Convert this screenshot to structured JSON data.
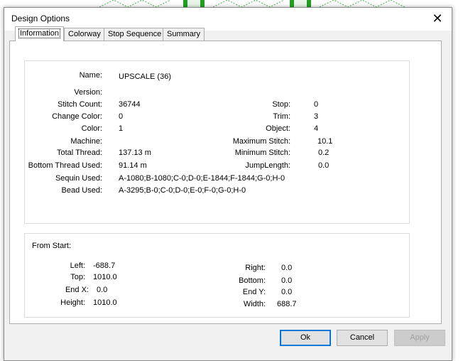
{
  "dialog": {
    "title": "Design Options"
  },
  "tabs": [
    {
      "label": "Information"
    },
    {
      "label": "Colorway"
    },
    {
      "label": "Stop Sequence"
    },
    {
      "label": "Summary"
    }
  ],
  "info": {
    "name": {
      "label": "Name:",
      "value": "UPSCALE (36)"
    },
    "version": {
      "label": "Version:",
      "value": ""
    },
    "stitch_count": {
      "label": "Stitch Count:",
      "value": "36744"
    },
    "change_color": {
      "label": "Change Color:",
      "value": "0"
    },
    "color": {
      "label": "Color:",
      "value": "1"
    },
    "machine": {
      "label": "Machine:",
      "value": ""
    },
    "total_thread": {
      "label": "Total Thread:",
      "value": "137.13 m"
    },
    "bottom_thread": {
      "label": "Bottom Thread Used:",
      "value": "91.14 m"
    },
    "sequin_used": {
      "label": "Sequin Used:",
      "value": "A-1080;B-1080;C-0;D-0;E-1844;F-1844;G-0;H-0"
    },
    "bead_used": {
      "label": "Bead Used:",
      "value": "A-3295;B-0;C-0;D-0;E-0;F-0;G-0;H-0"
    },
    "stop": {
      "label": "Stop:",
      "value": "0"
    },
    "trim": {
      "label": "Trim:",
      "value": "3"
    },
    "object": {
      "label": "Object:",
      "value": "4"
    },
    "max_stitch": {
      "label": "Maximum Stitch:",
      "value": "10.1"
    },
    "min_stitch": {
      "label": "Minimum Stitch:",
      "value": "0.2"
    },
    "jump_length": {
      "label": "JumpLength:",
      "value": "0.0"
    }
  },
  "from_start": {
    "heading": "From Start:",
    "left": {
      "label": "Left:",
      "value": "-688.7"
    },
    "top": {
      "label": "Top:",
      "value": "1010.0"
    },
    "end_x": {
      "label": "End X:",
      "value": "0.0"
    },
    "height": {
      "label": "Height:",
      "value": "1010.0"
    },
    "right": {
      "label": "Right:",
      "value": "0.0"
    },
    "bottom": {
      "label": "Bottom:",
      "value": "0.0"
    },
    "end_y": {
      "label": "End Y:",
      "value": "0.0"
    },
    "width": {
      "label": "Width:",
      "value": "688.7"
    }
  },
  "buttons": {
    "ok": "Ok",
    "cancel": "Cancel",
    "apply": "Apply"
  },
  "icons": {
    "close": "close-icon"
  },
  "colors": {
    "accent": "#0078d7",
    "background_art_green": "#22a022"
  }
}
